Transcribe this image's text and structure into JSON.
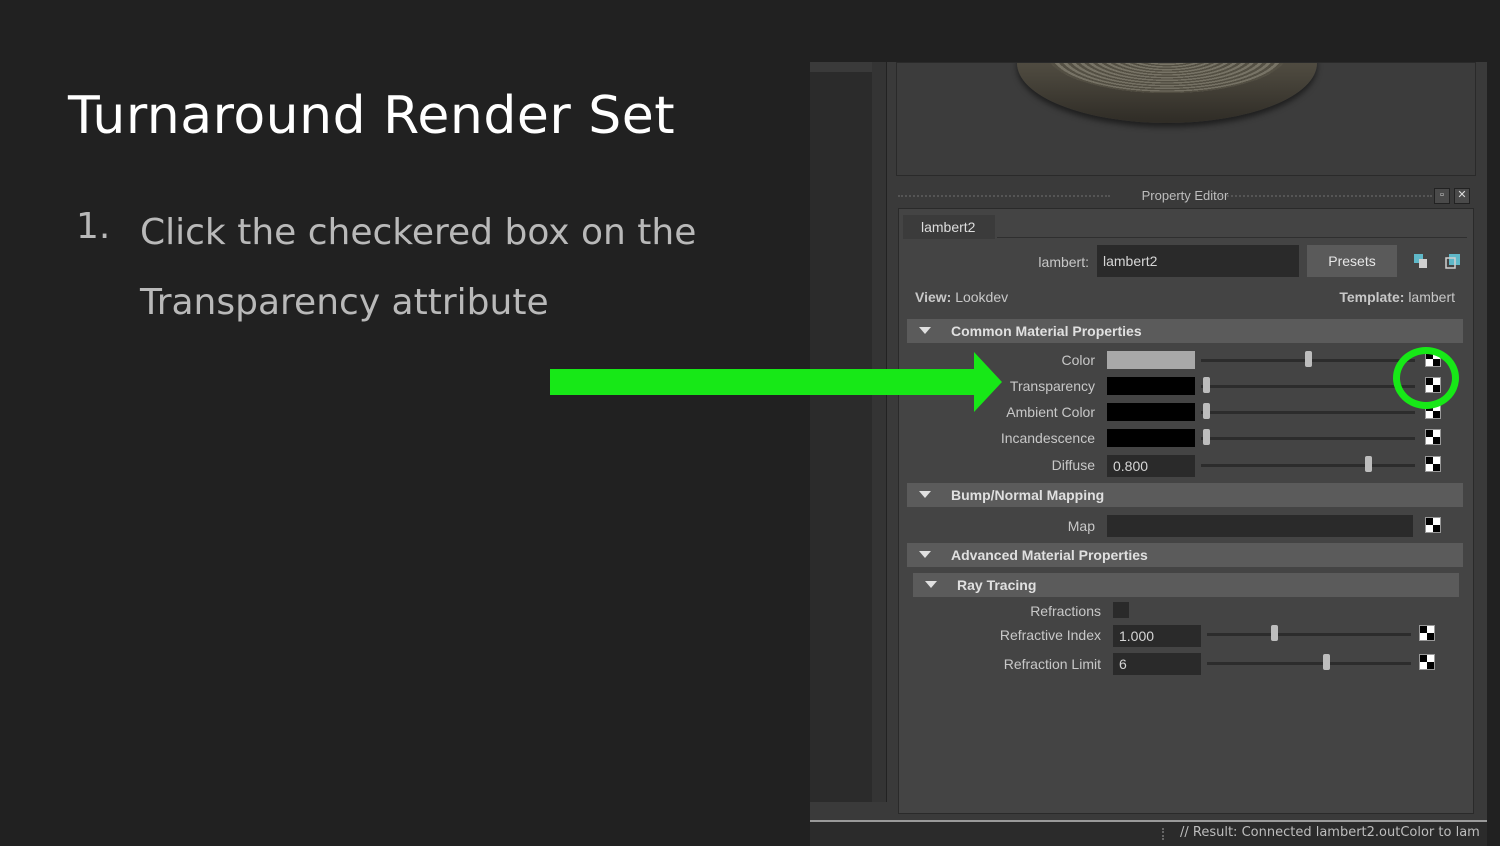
{
  "slide": {
    "title": "Turnaround Render Set",
    "step_number": "1.",
    "step_text": "Click the checkered box on the Transparency attribute"
  },
  "property_editor": {
    "header": "Property Editor",
    "tab": "lambert2",
    "lambert_label": "lambert:",
    "lambert_value": "lambert2",
    "presets_label": "Presets",
    "view_label": "View:",
    "view_value": "Lookdev",
    "template_label": "Template:",
    "template_value": "lambert",
    "sections": {
      "common": "Common Material Properties",
      "bump": "Bump/Normal Mapping",
      "advanced": "Advanced Material Properties",
      "ray_tracing": "Ray Tracing"
    },
    "attributes": {
      "color": "Color",
      "transparency": "Transparency",
      "ambient": "Ambient Color",
      "incandescence": "Incandescence",
      "diffuse": "Diffuse",
      "diffuse_value": "0.800",
      "map": "Map",
      "refractions": "Refractions",
      "refractive_index": "Refractive Index",
      "refractive_index_value": "1.000",
      "refraction_limit": "Refraction Limit",
      "refraction_limit_value": "6"
    }
  },
  "status": {
    "text": "// Result: Connected lambert2.outColor to lam"
  },
  "colors": {
    "highlight": "#17e817",
    "background": "#212121"
  }
}
